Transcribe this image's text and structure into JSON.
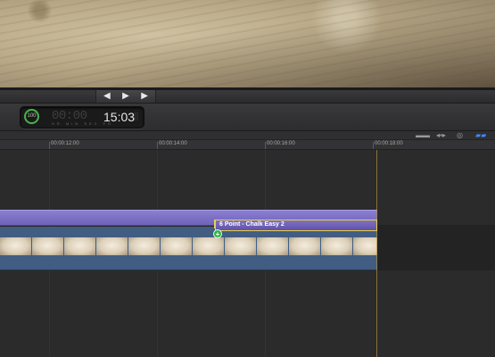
{
  "transport": {
    "prev_icon": "skip-back-icon",
    "play_icon": "play-icon",
    "next_icon": "skip-forward-icon",
    "prev_glyph": "◀",
    "play_glyph": "▶",
    "next_glyph": "▶"
  },
  "dashboard": {
    "gauge_value": "100",
    "timecode_faded": "00:00",
    "timecode": "15:03",
    "units": "HR MIN SEC FR",
    "tail": "||"
  },
  "ruler": {
    "ticks": [
      "00:00:12:00",
      "00:00:14:00",
      "00:00:16:00",
      "00:00:18:00"
    ]
  },
  "clips": {
    "selected_title": "6 Point - Chalk Easy 2",
    "add_glyph": "+"
  },
  "toolbar_icons": [
    "audio-skimming-icon",
    "skimming-icon",
    "solo-icon",
    "snapping-icon"
  ],
  "colors": {
    "title_clip": "#7e71c6",
    "video_clip": "#415d82",
    "selection": "#e7cf4a",
    "playhead": "#b4913c",
    "active_icon": "#3b8cff"
  }
}
